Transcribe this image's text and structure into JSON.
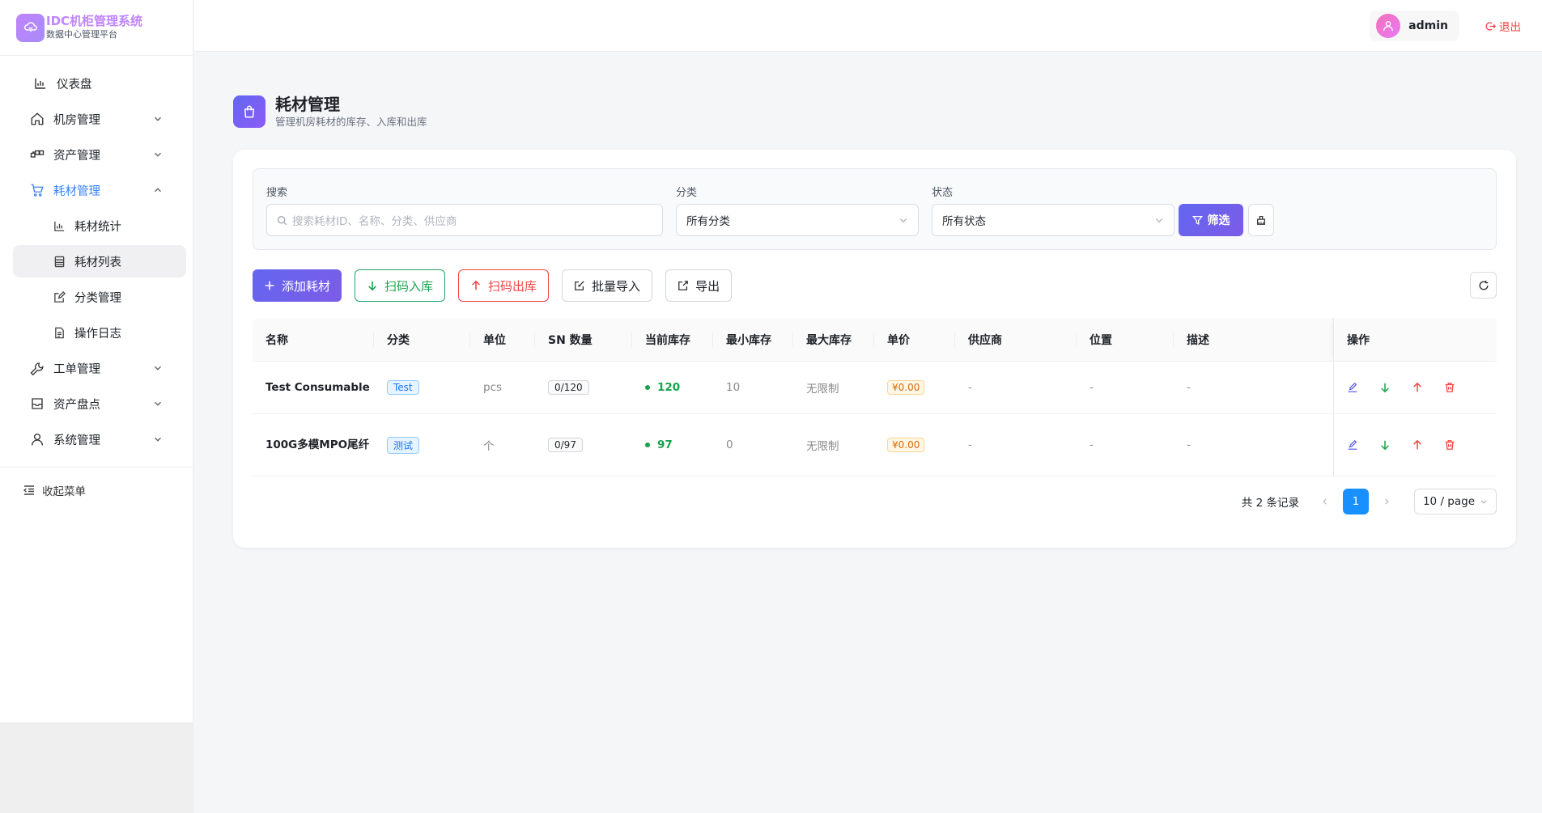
{
  "brand": {
    "title": "IDC机柜管理系统",
    "subtitle": "数据中心管理平台"
  },
  "sidebar": {
    "items": [
      {
        "label": "仪表盘",
        "icon": "bar-chart-icon"
      },
      {
        "label": "机房管理",
        "icon": "home-icon"
      },
      {
        "label": "资产管理",
        "icon": "cluster-icon"
      },
      {
        "label": "耗材管理",
        "icon": "cart-icon"
      },
      {
        "label": "工单管理",
        "icon": "wrench-icon"
      },
      {
        "label": "资产盘点",
        "icon": "inbox-icon"
      },
      {
        "label": "系统管理",
        "icon": "user-icon"
      }
    ],
    "subitems": [
      {
        "label": "耗材统计",
        "icon": "bar-chart-icon"
      },
      {
        "label": "耗材列表",
        "icon": "list-icon"
      },
      {
        "label": "分类管理",
        "icon": "edit-square-icon"
      },
      {
        "label": "操作日志",
        "icon": "file-icon"
      }
    ],
    "collapse_label": "收起菜单"
  },
  "header": {
    "username": "admin",
    "logout_label": "退出"
  },
  "page": {
    "title": "耗材管理",
    "subtitle": "管理机房耗材的库存、入库和出库"
  },
  "filters": {
    "search_label": "搜索",
    "search_placeholder": "搜索耗材ID、名称、分类、供应商",
    "category_label": "分类",
    "category_value": "所有分类",
    "status_label": "状态",
    "status_value": "所有状态",
    "filter_button": "筛选"
  },
  "toolbar": {
    "add": "添加耗材",
    "scan_in": "扫码入库",
    "scan_out": "扫码出库",
    "batch_import": "批量导入",
    "export": "导出"
  },
  "table": {
    "columns": [
      "名称",
      "分类",
      "单位",
      "SN 数量",
      "当前库存",
      "最小库存",
      "最大库存",
      "单价",
      "供应商",
      "位置",
      "描述",
      "操作"
    ],
    "rows": [
      {
        "name": "Test Consumable",
        "category": "Test",
        "unit": "pcs",
        "sn": "0/120",
        "stock": "120",
        "min": "10",
        "max": "无限制",
        "price": "¥0.00",
        "supplier": "-",
        "location": "-",
        "desc": "-"
      },
      {
        "name": "100G多模MPO尾纤",
        "category": "测试",
        "unit": "个",
        "sn": "0/97",
        "stock": "97",
        "min": "0",
        "max": "无限制",
        "price": "¥0.00",
        "supplier": "-",
        "location": "-",
        "desc": "-"
      }
    ]
  },
  "pagination": {
    "total": "共 2 条记录",
    "current_page": "1",
    "page_size": "10 / page"
  },
  "colors": {
    "accent": "#6366f1",
    "active_menu": "#3b82f6",
    "success": "#16a34a",
    "danger": "#ef4444"
  }
}
